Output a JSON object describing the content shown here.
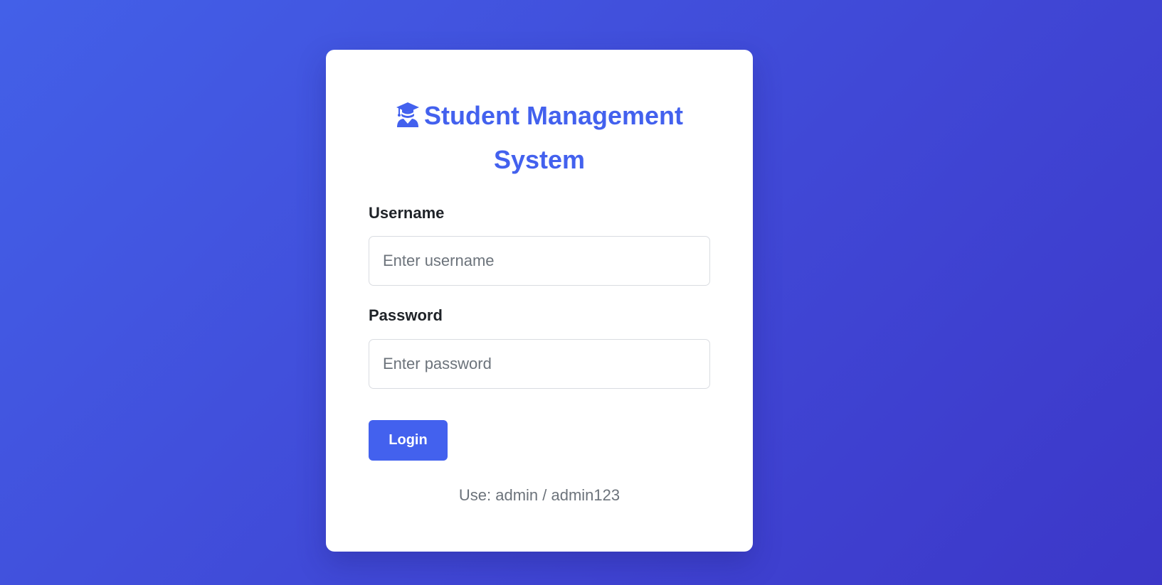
{
  "login": {
    "title_line1": "Student Management",
    "title_line2": "System",
    "title_icon": "graduation-cap-icon",
    "username_label": "Username",
    "username_placeholder": "Enter username",
    "username_value": "",
    "password_label": "Password",
    "password_placeholder": "Enter password",
    "password_value": "",
    "login_button": "Login",
    "hint": "Use: admin / admin123"
  },
  "colors": {
    "accent": "#4361ee",
    "background_start": "#4360e8",
    "background_end": "#3c37c8",
    "card": "#ffffff",
    "hint_text": "#6c737b"
  }
}
